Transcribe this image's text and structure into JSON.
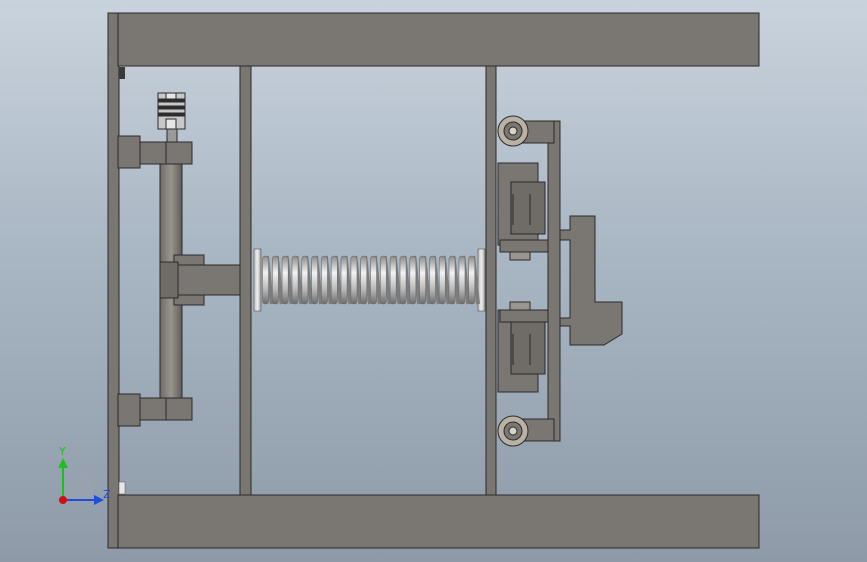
{
  "viewport": {
    "background_top": "#c9d3dd",
    "background_bottom": "#8e9aa8"
  },
  "colors": {
    "frame": "#7a7671",
    "frame_edge": "#2b2b2b",
    "spring": "#d8d8d8",
    "spring_shadow": "#8c8c8c",
    "wheel": "#b9b2a4",
    "coupling": "#c8c8c8"
  },
  "triad": {
    "icon": "coordinate-triad-icon",
    "y_label": "Y",
    "z_label": "Z",
    "y_color": "#1fbf1f",
    "z_color": "#1f4fd8",
    "x_color": "#d01010"
  }
}
